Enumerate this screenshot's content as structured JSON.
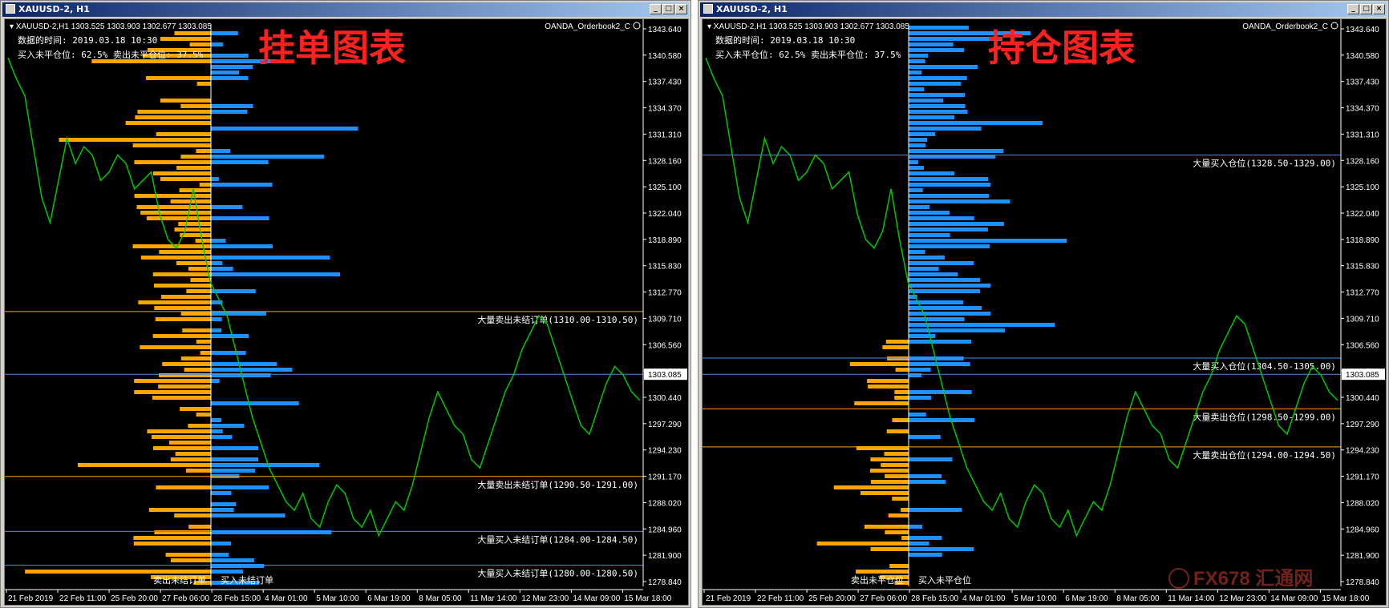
{
  "left": {
    "window_title": "XAUUSD-2, H1",
    "header_symbol": "XAUUSD-2,H1",
    "header_ohlc": "1303.525 1303.903 1302.677 1303.085",
    "indicator_name": "OANDA_Orderbook2_C",
    "data_time": "数据的时间: 2019.03.18 10:30",
    "positions": "买入未平仓位: 62.5%  卖出未平仓位: 37.5%",
    "big_title": "挂单图表",
    "bottom_left_label": "卖出未结订单",
    "bottom_right_label": "买入未结订单",
    "levels": [
      {
        "price": 1310.5,
        "color": "#ffa500",
        "label": "大量卖出未结订单(1310.00-1310.50)"
      },
      {
        "price": 1291.0,
        "color": "#ffa500",
        "label": "大量卖出未结订单(1290.50-1291.00)"
      },
      {
        "price": 1284.5,
        "color": "#4a90e2",
        "label": "大量买入未结订单(1284.00-1284.50)"
      },
      {
        "price": 1280.5,
        "color": "#4a90e2",
        "label": "大量买入未结订单(1280.00-1280.50)"
      }
    ]
  },
  "right": {
    "window_title": "XAUUSD-2, H1",
    "header_symbol": "XAUUSD-2,H1",
    "header_ohlc": "1303.525 1303.903 1302.677 1303.085",
    "indicator_name": "OANDA_Orderbook2_C",
    "data_time": "数据的时间: 2019.03.18 10:30",
    "positions": "买入未平仓位: 62.5%  卖出未平仓位: 37.5%",
    "big_title": "持仓图表",
    "bottom_left_label": "卖出未平仓位",
    "bottom_right_label": "买入未平仓位",
    "levels": [
      {
        "price": 1329.0,
        "color": "#4a90e2",
        "label": "大量买入仓位(1328.50-1329.00)"
      },
      {
        "price": 1305.0,
        "color": "#4a90e2",
        "label": "大量买入仓位(1304.50-1305.00)"
      },
      {
        "price": 1299.0,
        "color": "#ffa500",
        "label": "大量卖出仓位(1298.50-1299.00)"
      },
      {
        "price": 1294.5,
        "color": "#ffa500",
        "label": "大量卖出仓位(1294.00-1294.50)"
      }
    ]
  },
  "price_axis": [
    "1343.640",
    "1340.580",
    "1337.430",
    "1334.370",
    "1331.310",
    "1328.160",
    "1325.100",
    "1322.040",
    "1318.890",
    "1315.830",
    "1312.770",
    "1309.710",
    "1306.560",
    "1303.500",
    "1300.440",
    "1297.290",
    "1294.230",
    "1291.170",
    "1288.020",
    "1284.960",
    "1281.900",
    "1278.840"
  ],
  "current_price": "1303.085",
  "time_axis": [
    "21 Feb 2019",
    "22 Feb 11:00",
    "25 Feb 20:00",
    "27 Feb 06:00",
    "28 Feb 15:00",
    "4 Mar 01:00",
    "5 Mar 10:00",
    "6 Mar 19:00",
    "8 Mar 05:00",
    "11 Mar 14:00",
    "12 Mar 23:00",
    "14 Mar 09:00",
    "15 Mar 18:00"
  ],
  "watermark": "FX678 汇通网",
  "colors": {
    "sell": "#ffa500",
    "buy": "#1e90ff",
    "price_line": "#00c800",
    "background": "#000000"
  },
  "price_series": [
    1340.5,
    1338,
    1336,
    1330,
    1324,
    1321,
    1326,
    1331,
    1328,
    1330,
    1329,
    1326,
    1327,
    1329,
    1328,
    1325,
    1326,
    1327,
    1322,
    1319,
    1318,
    1320,
    1325,
    1319,
    1314,
    1312,
    1310,
    1306,
    1302,
    1298,
    1295,
    1292,
    1290,
    1288,
    1287,
    1289,
    1286,
    1285,
    1288,
    1290,
    1289,
    1286,
    1285,
    1287,
    1284,
    1286,
    1288,
    1287,
    1290,
    1294,
    1298,
    1301,
    1299,
    1297,
    1296,
    1293,
    1292,
    1295,
    1298,
    1301,
    1303,
    1306,
    1308,
    1310,
    1309,
    1306,
    1303,
    1300,
    1297,
    1296,
    1299,
    1302,
    1304,
    1303,
    1301,
    1300
  ]
}
